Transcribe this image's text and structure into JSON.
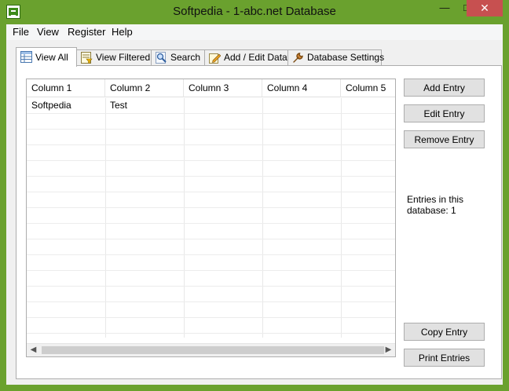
{
  "window": {
    "title": "Softpedia - 1-abc.net Database",
    "minimize_glyph": "—",
    "maximize_glyph": "□",
    "close_glyph": "✕"
  },
  "menu": [
    "File",
    "View",
    "Register",
    "Help"
  ],
  "tabs": [
    {
      "label": "View All",
      "icon": "table-icon",
      "active": true
    },
    {
      "label": "View Filtered",
      "icon": "filter-icon",
      "active": false
    },
    {
      "label": "Search",
      "icon": "magnifier-icon",
      "active": false
    },
    {
      "label": "Add / Edit Data",
      "icon": "edit-pencil-icon",
      "active": false
    },
    {
      "label": "Database Settings",
      "icon": "wrench-icon",
      "active": false
    }
  ],
  "grid": {
    "columns": [
      "Column 1",
      "Column 2",
      "Column 3",
      "Column 4",
      "Column 5"
    ],
    "rows": [
      [
        "Softpedia",
        "Test",
        "",
        "",
        ""
      ]
    ],
    "scroll_left_glyph": "◀",
    "scroll_right_glyph": "▶"
  },
  "buttons": {
    "add": "Add Entry",
    "edit": "Edit Entry",
    "remove": "Remove Entry",
    "copy": "Copy Entry",
    "print": "Print Entries"
  },
  "info": {
    "entries_text": "Entries in this database: 1"
  },
  "colors": {
    "titlebar": "#6aa12e",
    "close_button": "#c75050"
  }
}
